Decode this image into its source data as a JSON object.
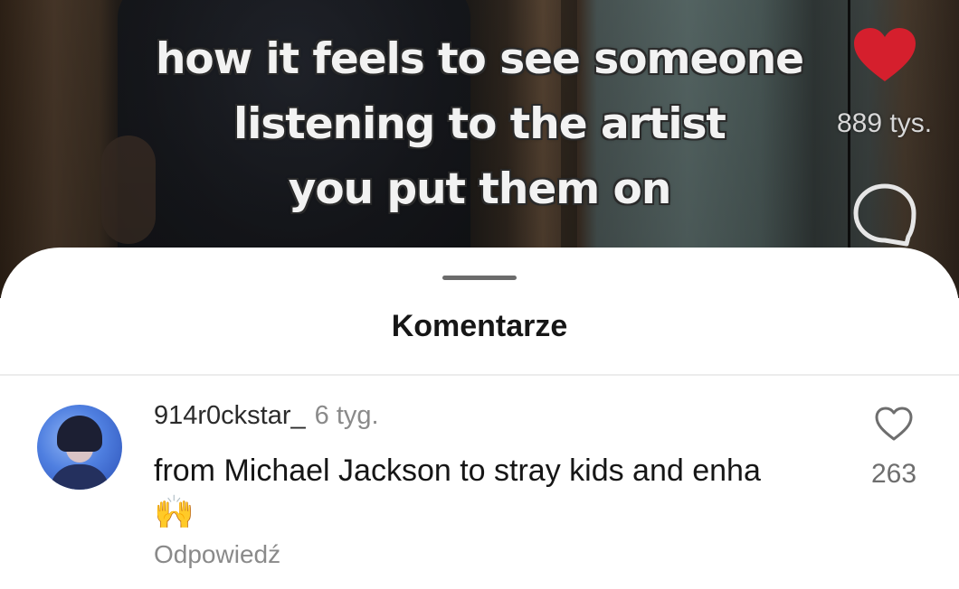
{
  "video": {
    "caption_lines": [
      "how it feels to see someone",
      "listening to the artist",
      "you put them on"
    ],
    "likes": "889 tys.",
    "heart_color": "#e02a35"
  },
  "sheet": {
    "title": "Komentarze"
  },
  "comment": {
    "username": "914r0ckstar_",
    "time": "6 tyg.",
    "text": "from Michael Jackson to stray kids and enha",
    "emoji": "🙌",
    "reply_label": "Odpowiedź",
    "likes": "263"
  },
  "icons": {
    "like": "heart-icon",
    "comment": "comment-bubble-icon",
    "comment_like": "heart-outline-icon"
  }
}
